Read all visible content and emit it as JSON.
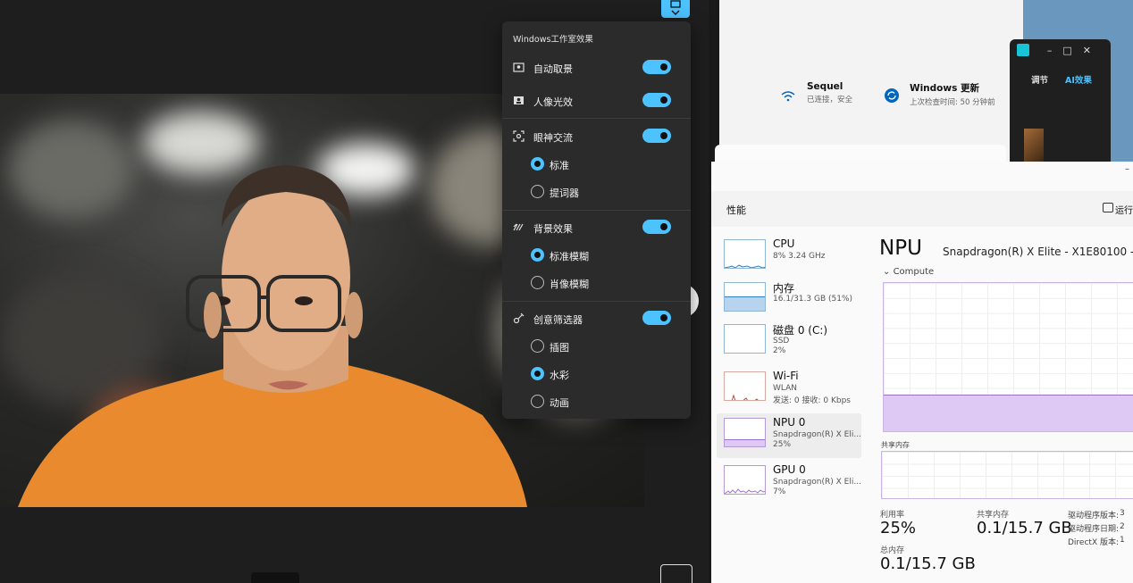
{
  "effects_panel": {
    "title": "Windows工作室效果",
    "items": [
      {
        "label": "自动取景",
        "icon": "frame-icon",
        "enabled": true
      },
      {
        "label": "人像光效",
        "icon": "portrait-light-icon",
        "enabled": true
      },
      {
        "label": "眼神交流",
        "icon": "eye-contact-icon",
        "enabled": true,
        "options": [
          {
            "label": "标准",
            "selected": true
          },
          {
            "label": "提词器",
            "selected": false
          }
        ]
      },
      {
        "label": "背景效果",
        "icon": "background-icon",
        "enabled": true,
        "options": [
          {
            "label": "标准模糊",
            "selected": true
          },
          {
            "label": "肖像模糊",
            "selected": false
          }
        ]
      },
      {
        "label": "创意筛选器",
        "icon": "creative-filter-icon",
        "enabled": true,
        "options": [
          {
            "label": "插图",
            "selected": false
          },
          {
            "label": "水彩",
            "selected": true
          },
          {
            "label": "动画",
            "selected": false
          }
        ]
      }
    ]
  },
  "settings": {
    "wifi": {
      "name": "Sequel",
      "status": "已连接，安全"
    },
    "update": {
      "name": "Windows 更新",
      "status": "上次检查时间: 50 分钟前"
    }
  },
  "mini_window": {
    "tab1": "调节",
    "tab2": "AI效果",
    "controls": "–□✕"
  },
  "task_manager": {
    "header_title": "性能",
    "run_label": "运行",
    "minimize": "–",
    "items": [
      {
        "name": "CPU",
        "sub1": "8%  3.24 GHz",
        "sub2": ""
      },
      {
        "name": "内存",
        "sub1": "16.1/31.3 GB (51%)",
        "sub2": ""
      },
      {
        "name": "磁盘 0 (C:)",
        "sub1": "SSD",
        "sub2": "2%"
      },
      {
        "name": "Wi-Fi",
        "sub1": "WLAN",
        "sub2": "发送: 0 接收: 0 Kbps"
      },
      {
        "name": "NPU 0",
        "sub1": "Snapdragon(R) X Eli...",
        "sub2": "25%"
      },
      {
        "name": "GPU 0",
        "sub1": "Snapdragon(R) X Eli...",
        "sub2": "7%"
      }
    ],
    "detail": {
      "title": "NPU",
      "model": "Snapdragon(R) X Elite - X1E80100 -",
      "compute_label": "Compute",
      "compute_level": 0.25,
      "shared_memory_label": "共享内存",
      "utilization_label": "利用率",
      "utilization_value": "25%",
      "shared_label": "共享内存",
      "shared_value": "0.1/15.7 GB",
      "total_label": "总内存",
      "total_value": "0.1/15.7 GB",
      "driver_version_label": "驱动程序版本:",
      "driver_date_label": "驱动程序日期:",
      "directx_label": "DirectX 版本:",
      "driver_version_value": "3",
      "driver_date_value": "2",
      "directx_value": "1"
    }
  },
  "colors": {
    "accent": "#4cc2ff",
    "npu_purple": "#9b70cf"
  }
}
